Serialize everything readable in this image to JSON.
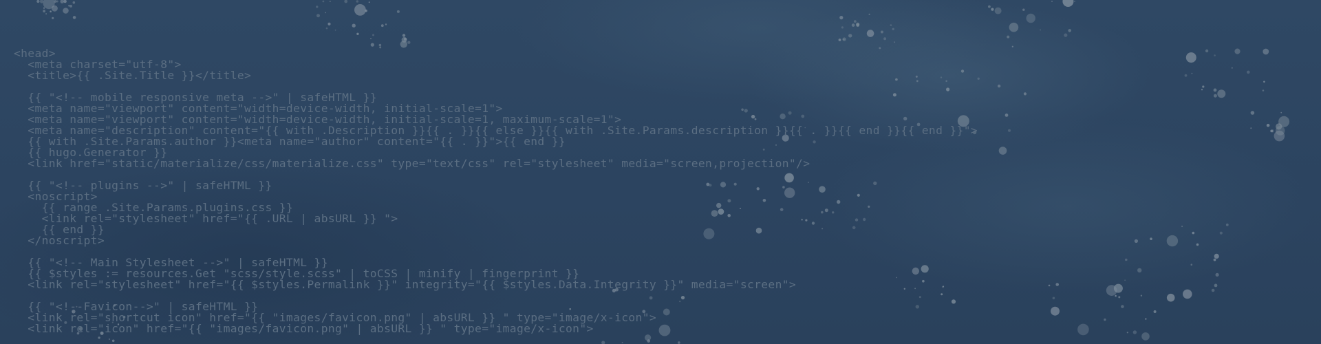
{
  "code_lines": [
    "<head>",
    "  <meta charset=\"utf-8\">",
    "  <title>{{ .Site.Title }}</title>",
    "",
    "  {{ \"<!-- mobile responsive meta -->\" | safeHTML }}",
    "  <meta name=\"viewport\" content=\"width=device-width, initial-scale=1\">",
    "  <meta name=\"viewport\" content=\"width=device-width, initial-scale=1, maximum-scale=1\">",
    "  <meta name=\"description\" content=\"{{ with .Description }}{{ . }}{{ else }}{{ with .Site.Params.description }}{{ . }}{{ end }}{{ end }}\">",
    "  {{ with .Site.Params.author }}<meta name=\"author\" content=\"{{ . }}\">{{ end }}",
    "  {{ hugo.Generator }}",
    "  <link href=\"static/materialize/css/materialize.css\" type=\"text/css\" rel=\"stylesheet\" media=\"screen,projection\"/>",
    "",
    "  {{ \"<!-- plugins -->\" | safeHTML }}",
    "  <noscript>",
    "    {{ range .Site.Params.plugins.css }}",
    "    <link rel=\"stylesheet\" href=\"{{ .URL | absURL }} \">",
    "    {{ end }}",
    "  </noscript>",
    "",
    "  {{ \"<!-- Main Stylesheet -->\" | safeHTML }}",
    "  {{ $styles := resources.Get \"scss/style.scss\" | toCSS | minify | fingerprint }}",
    "  <link rel=\"stylesheet\" href=\"{{ $styles.Permalink }}\" integrity=\"{{ $styles.Data.Integrity }}\" media=\"screen\">",
    "",
    "  {{ \"<!--Favicon-->\" | safeHTML }}",
    "  <link rel=\"shortcut icon\" href=\"{{ \"images/favicon.png\" | absURL }} \" type=\"image/x-icon\">",
    "  <link rel=\"icon\" href=\"{{ \"images/favicon.png\" | absURL }} \" type=\"image/x-icon\">"
  ],
  "colors": {
    "background": "#2d4561",
    "code_text": "#5b6e82",
    "splatter": "#7f8e9c"
  }
}
